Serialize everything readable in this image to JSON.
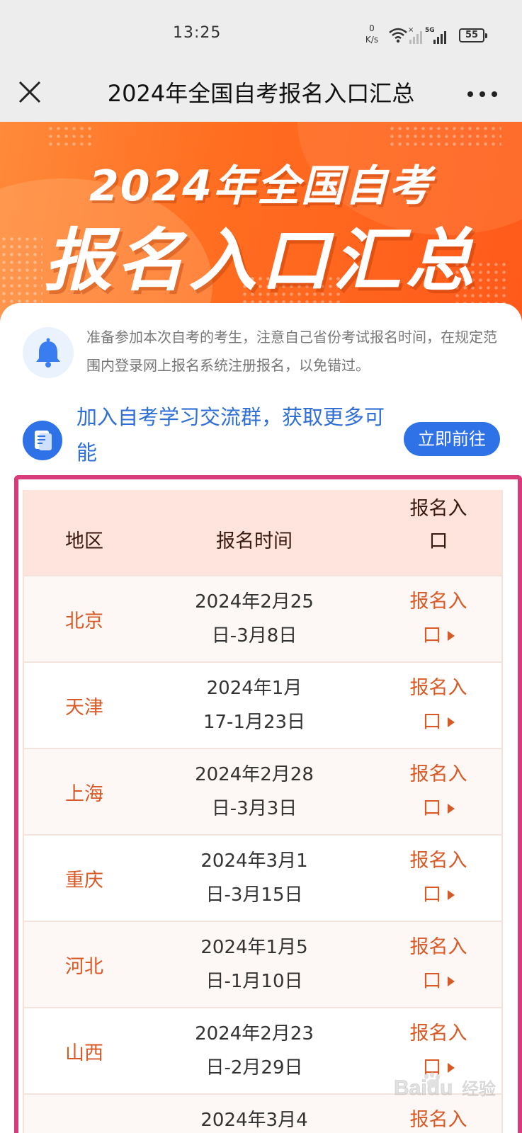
{
  "status_bar": {
    "time": "13:25",
    "net_speed_value": "0",
    "net_speed_unit": "K/s",
    "signal_label": "5G",
    "battery": "55"
  },
  "nav": {
    "title": "2024年全国自考报名入口汇总",
    "close_icon": "close-icon",
    "more_icon": "more-icon"
  },
  "banner": {
    "line1": "2024年全国自考",
    "line2": "报名入口汇总"
  },
  "notice": {
    "icon": "bell-icon",
    "text": "准备参加本次自考的考生，注意自己省份考试报名时间，在规定范围内登录网上报名系统注册报名，以免错过。"
  },
  "group": {
    "icon": "document-icon",
    "text": "加入自考学习交流群，获取更多可能",
    "button_label": "立即前往"
  },
  "table": {
    "headers": {
      "region": "地区",
      "time": "报名时间",
      "entry_line1": "报名入",
      "entry_line2": "口"
    },
    "rows": [
      {
        "region": "北京",
        "time_line1": "2024年2月25",
        "time_line2": "日-3月8日",
        "link_line1": "报名入",
        "link_line2": "口"
      },
      {
        "region": "天津",
        "time_line1": "2024年1月",
        "time_line2": "17-1月23日",
        "link_line1": "报名入",
        "link_line2": "口"
      },
      {
        "region": "上海",
        "time_line1": "2024年2月28",
        "time_line2": "日-3月3日",
        "link_line1": "报名入",
        "link_line2": "口"
      },
      {
        "region": "重庆",
        "time_line1": "2024年3月1",
        "time_line2": "日-3月15日",
        "link_line1": "报名入",
        "link_line2": "口"
      },
      {
        "region": "河北",
        "time_line1": "2024年1月5",
        "time_line2": "日-1月10日",
        "link_line1": "报名入",
        "link_line2": "口"
      },
      {
        "region": "山西",
        "time_line1": "2024年2月23",
        "time_line2": "日-2月29日",
        "link_line1": "报名入",
        "link_line2": "口"
      },
      {
        "region": "",
        "time_line1": "2024年3月4",
        "time_line2": "",
        "link_line1": "报名入",
        "link_line2": ""
      }
    ]
  },
  "watermark": {
    "brand": "Baidu",
    "suffix": "经验"
  },
  "colors": {
    "accent_orange": "#d85a26",
    "accent_blue": "#2f72e8",
    "highlight_pink": "#d93a7a",
    "header_bg": "#fee4dc"
  }
}
